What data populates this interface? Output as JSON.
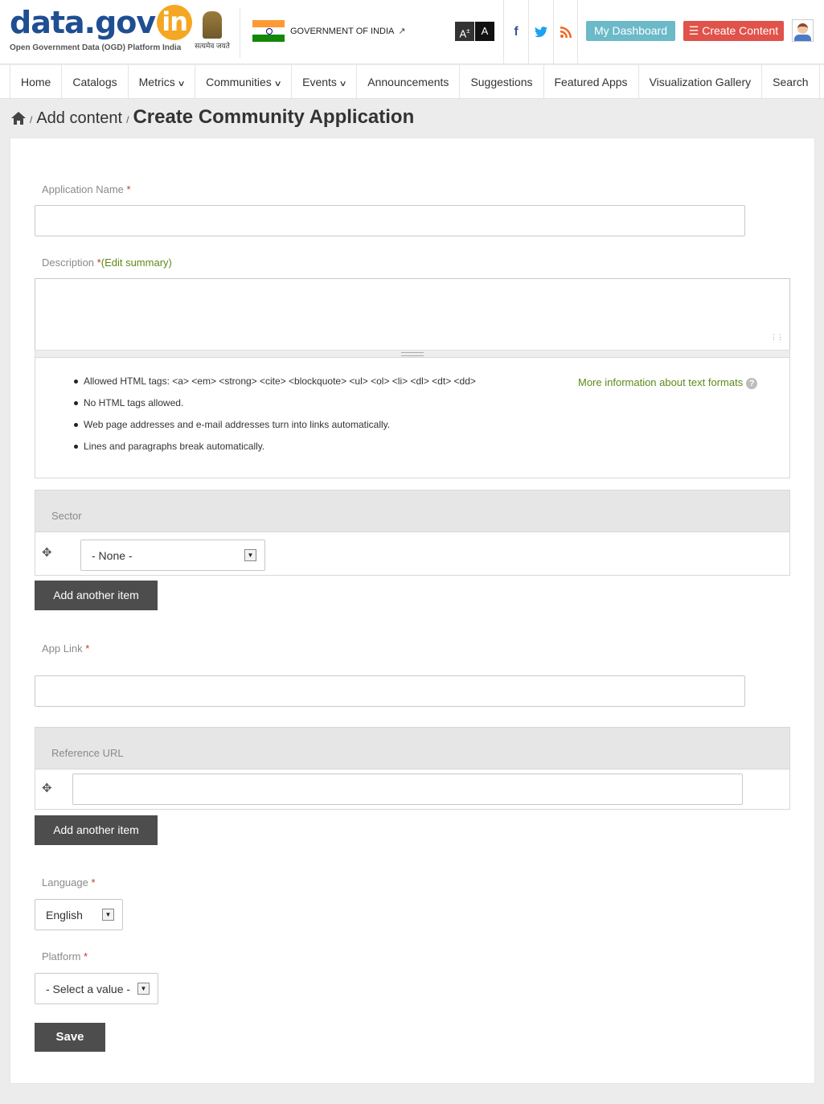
{
  "header": {
    "logo_main": "data.gov",
    "logo_in": "in",
    "logo_sub": "Open Government Data (OGD) Platform India",
    "emblem_text": "सत्यमेव जयते",
    "government_label": "GOVERNMENT OF INDIA",
    "font_increase_label": "A",
    "font_contrast_label": "A",
    "facebook_icon": "f",
    "twitter_icon": "t",
    "rss_icon": "rss",
    "dashboard_label": "My Dashboard",
    "create_content_label": "☰ Create Content"
  },
  "nav": {
    "items": [
      {
        "label": "Home"
      },
      {
        "label": "Catalogs"
      },
      {
        "label": "Metrics"
      },
      {
        "label": "Communities"
      },
      {
        "label": "Events"
      },
      {
        "label": "Announcements"
      },
      {
        "label": "Suggestions"
      },
      {
        "label": "Featured Apps"
      },
      {
        "label": "Visualization Gallery"
      },
      {
        "label": "Search"
      }
    ]
  },
  "breadcrumb": {
    "add_content": "Add content",
    "sep": "/",
    "title": "Create Community Application"
  },
  "form": {
    "app_name_label": "Application Name",
    "required_mark": "*",
    "description_label": "Description",
    "edit_summary_link": "Edit summary",
    "formats": [
      "Allowed HTML tags: <a> <em> <strong> <cite> <blockquote> <ul> <ol> <li> <dl> <dt> <dd>",
      "No HTML tags allowed.",
      "Web page addresses and e-mail addresses turn into links automatically.",
      "Lines and paragraphs break automatically."
    ],
    "more_info_link": "More information about text formats",
    "help_icon": "?",
    "sector_label": "Sector",
    "sector_value": "- None -",
    "add_another_label": "Add another item",
    "app_link_label": "App Link",
    "reference_url_label": "Reference URL",
    "language_label": "Language",
    "language_value": "English",
    "platform_label": "Platform",
    "platform_value": "- Select a value -",
    "save_label": "Save"
  },
  "colors": {
    "brand_blue": "#1f4e92",
    "brand_orange": "#f5a623",
    "dashboard_button": "#6bb9c9",
    "create_button": "#e0524a",
    "link_green": "#5e8a18",
    "required_red": "#c0392b",
    "dark_button": "#4d4d4d"
  }
}
